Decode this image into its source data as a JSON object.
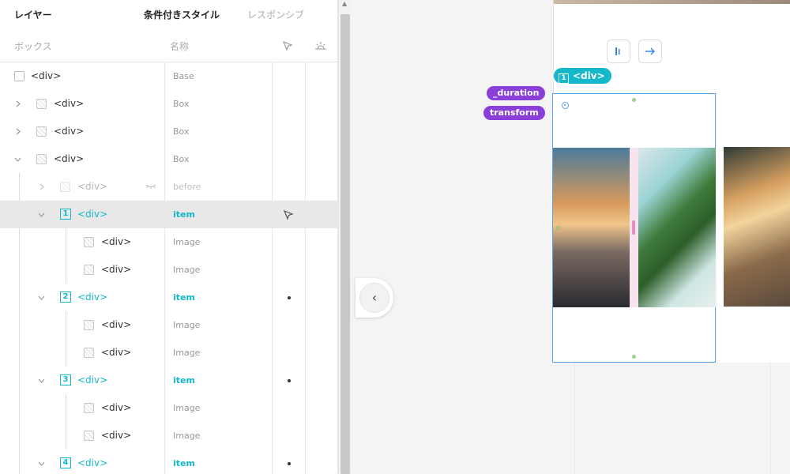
{
  "tabs": {
    "layers": "レイヤー",
    "conditional": "条件付きスタイル",
    "responsive": "レスポンシブ"
  },
  "columns": {
    "box": "ボックス",
    "name": "名称"
  },
  "rows": [
    {
      "tag": "<div>",
      "label": "Base"
    },
    {
      "tag": "<div>",
      "label": "Box"
    },
    {
      "tag": "<div>",
      "label": "Box"
    },
    {
      "tag": "<div>",
      "label": "Box"
    },
    {
      "tag": "<div>",
      "label": "before"
    },
    {
      "tag": "<div>",
      "label": "item",
      "badge": "1"
    },
    {
      "tag": "<div>",
      "label": "Image"
    },
    {
      "tag": "<div>",
      "label": "Image"
    },
    {
      "tag": "<div>",
      "label": "item",
      "badge": "2"
    },
    {
      "tag": "<div>",
      "label": "Image"
    },
    {
      "tag": "<div>",
      "label": "Image"
    },
    {
      "tag": "<div>",
      "label": "item",
      "badge": "3"
    },
    {
      "tag": "<div>",
      "label": "Image"
    },
    {
      "tag": "<div>",
      "label": "Image"
    },
    {
      "tag": "<div>",
      "label": "item",
      "badge": "4"
    }
  ],
  "canvas": {
    "tags": {
      "duration": "_duration",
      "transform": "transform"
    },
    "selected_item": {
      "badge": "1",
      "tag": "<div>"
    }
  },
  "colors": {
    "accent": "#14b8c8",
    "tag_purple": "#8b3fd9",
    "selection_blue": "#5aa0f0"
  }
}
